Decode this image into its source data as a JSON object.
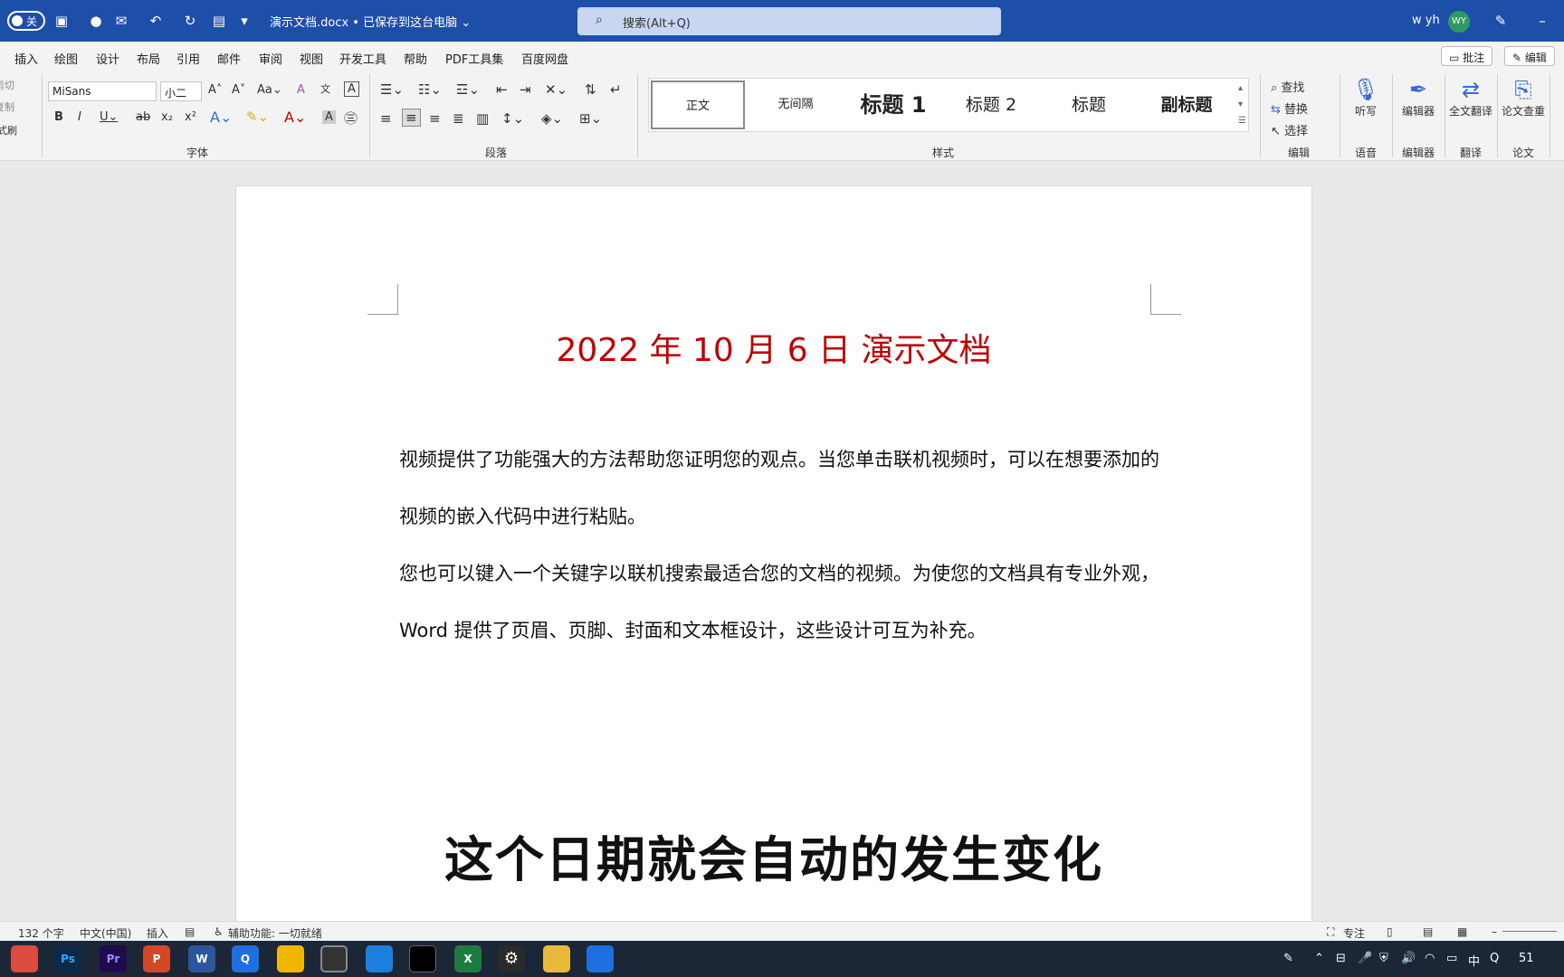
{
  "titlebar": {
    "autosave": "关",
    "doc_title": "演示文档.docx • 已保存到这台电脑 ⌄",
    "search_placeholder": "搜索(Alt+Q)",
    "user": "w yh",
    "avatar": "WY",
    "minimize": "–"
  },
  "menu": {
    "tabs": [
      "插入",
      "绘图",
      "设计",
      "布局",
      "引用",
      "邮件",
      "审阅",
      "视图",
      "开发工具",
      "帮助",
      "PDF工具集",
      "百度网盘"
    ],
    "comments": "批注",
    "edit": "编辑"
  },
  "ribbon": {
    "clipboard": {
      "cut": "剪切",
      "copy": "复制",
      "painter": "格式刷"
    },
    "font": {
      "name": "MiSans",
      "size": "小二",
      "group": "字体"
    },
    "paragraph": {
      "group": "段落"
    },
    "styles": {
      "group": "样式",
      "items": [
        "正文",
        "无间隔",
        "标题 1",
        "标题 2",
        "标题",
        "副标题"
      ]
    },
    "editing": {
      "find": "查找",
      "replace": "替换",
      "select": "选择",
      "group": "编辑"
    },
    "voice": {
      "dictate": "听写",
      "group": "语音"
    },
    "editor": {
      "label": "编辑器",
      "group": "编辑器"
    },
    "translate": {
      "label": "全文翻译",
      "group": "翻译"
    },
    "paper": {
      "label": "论文查重",
      "group": "论文"
    }
  },
  "document": {
    "title": "2022 年 10 月 6 日 演示文档",
    "paragraph1": "视频提供了功能强大的方法帮助您证明您的观点。当您单击联机视频时，可以在想要添加的视频的嵌入代码中进行粘贴。",
    "paragraph2": "您也可以键入一个关键字以联机搜索最适合您的文档的视频。为使您的文档具有专业外观，Word 提供了页眉、页脚、封面和文本框设计，这些设计可互为补充。",
    "overlay": "这个日期就会自动的发生变化"
  },
  "statusbar": {
    "word_count": "132 个字",
    "language": "中文(中国)",
    "mode": "插入",
    "accessibility": "辅助功能: 一切就绪",
    "focus": "专注"
  },
  "taskbar": {
    "apps": [
      "Chrome",
      "Ps",
      "Pr",
      "P",
      "W",
      "Q",
      "Files",
      "Clock",
      "Meet",
      "Cap",
      "X",
      "Settings",
      "Folder",
      "Q2"
    ],
    "ime": "中",
    "badge": "51"
  },
  "colors": {
    "titlebar": "#1e4fa8",
    "title_red": "#c00000"
  }
}
